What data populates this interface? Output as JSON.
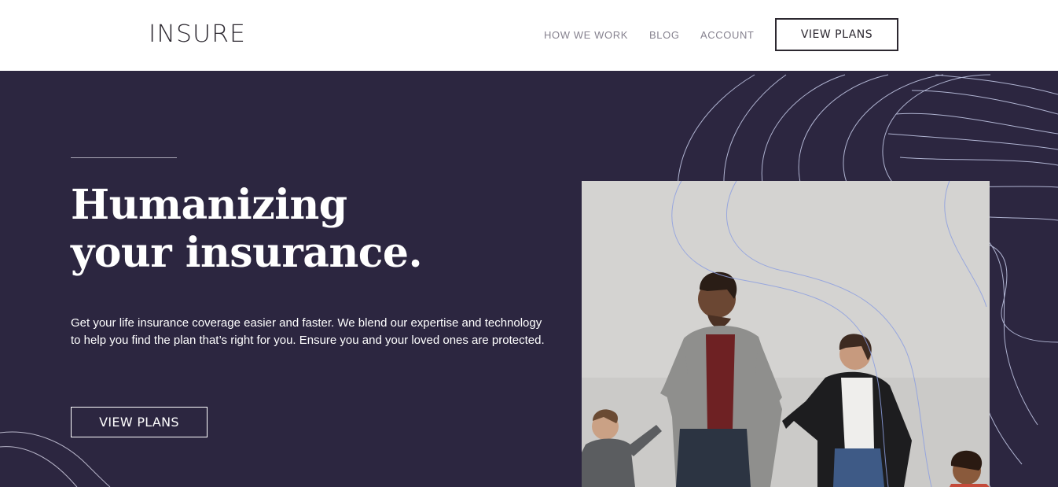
{
  "header": {
    "logo": "INSURE",
    "nav": {
      "how_we_work": "HOW WE WORK",
      "blog": "BLOG",
      "account": "ACCOUNT"
    },
    "cta_label": "VIEW PLANS"
  },
  "hero": {
    "title_line1": "Humanizing",
    "title_line2": "your insurance.",
    "description": "Get your life insurance coverage easier and faster. We blend our expertise and technology to help you find the plan that’s right for you. Ensure you and your loved ones are protected.",
    "cta_label": "VIEW PLANS"
  },
  "colors": {
    "hero_bg": "#2c2640",
    "dark_text": "#2c2830",
    "nav_text": "#86828f",
    "contour_lines": "#a8b3e6"
  },
  "icons": {
    "hero_image": "family-walking-photo",
    "background_pattern": "contour-lines-pattern"
  }
}
